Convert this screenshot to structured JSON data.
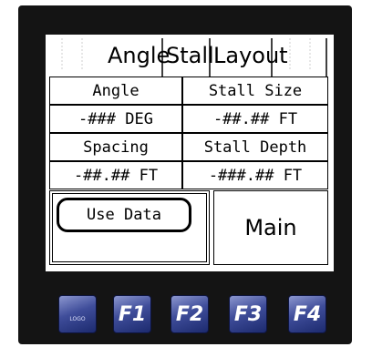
{
  "screen": {
    "title": {
      "word1": "Angle",
      "word2": "Stall",
      "word3": "Layout"
    },
    "grid": {
      "headers": [
        "Angle",
        "Stall Size",
        "Spacing",
        "Stall Depth"
      ],
      "values": [
        "-### DEG",
        "-##.## FT",
        "-##.## FT",
        "-###.## FT"
      ]
    },
    "buttons": {
      "use_data": "Use Data",
      "main": "Main"
    }
  },
  "function_keys": {
    "logo_label": "LOGO",
    "f1": "F1",
    "f2": "F2",
    "f3": "F3",
    "f4": "F4"
  }
}
